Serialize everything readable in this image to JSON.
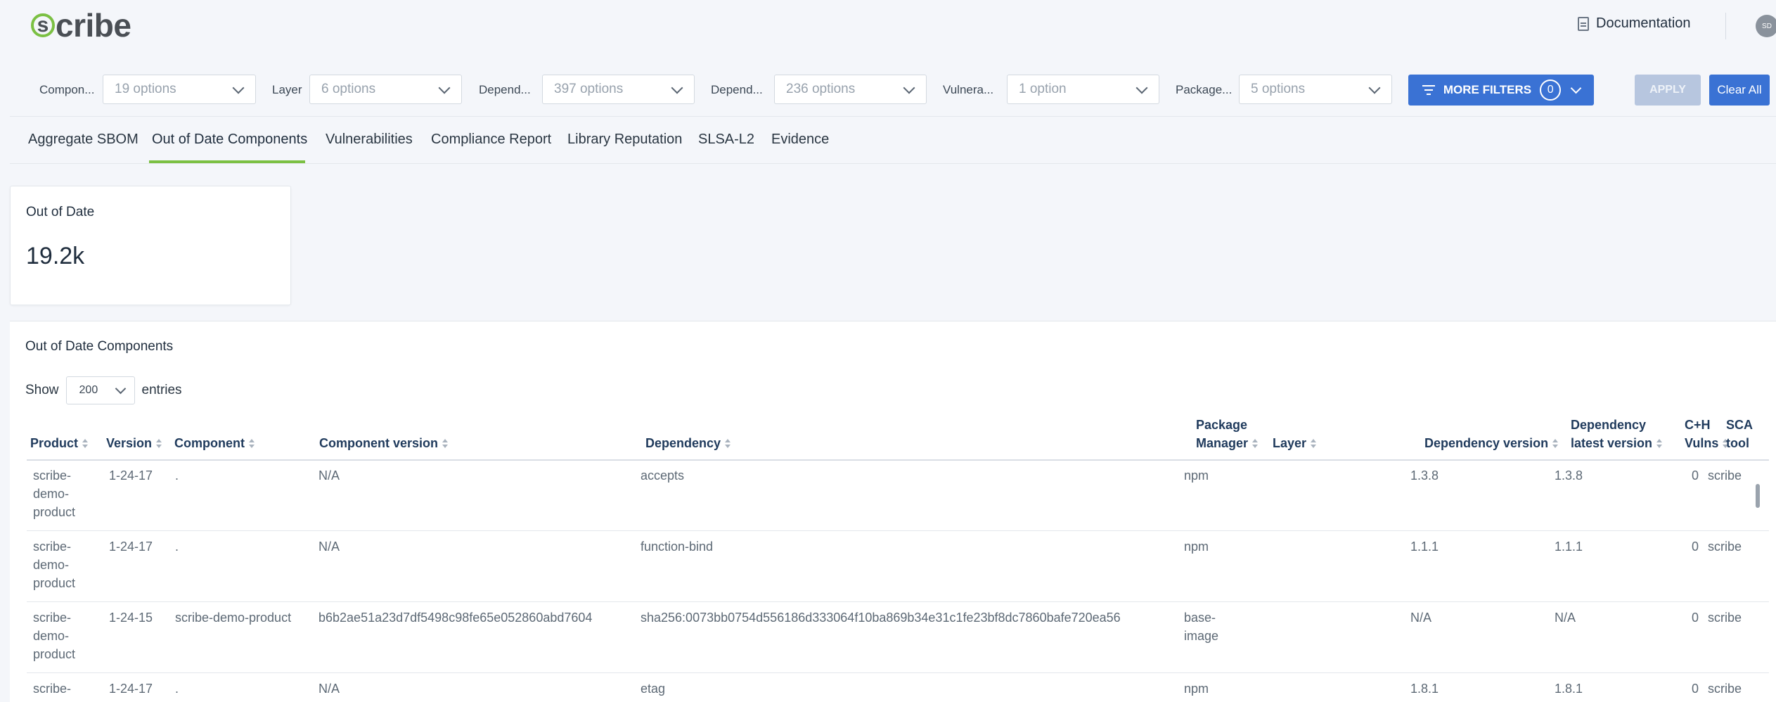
{
  "header": {
    "logo_initial": "s",
    "logo_rest": "cribe",
    "documentation": "Documentation",
    "avatar_initials": "SD"
  },
  "filters": {
    "items": [
      {
        "label": "Compon...",
        "value": "19 options"
      },
      {
        "label": "Layer",
        "value": "6 options"
      },
      {
        "label": "Depend...",
        "value": "397 options"
      },
      {
        "label": "Depend...",
        "value": "236 options"
      },
      {
        "label": "Vulnera...",
        "value": "1 option"
      },
      {
        "label": "Package...",
        "value": "5 options"
      }
    ],
    "more_filters": "MORE FILTERS",
    "more_filters_count": "0",
    "apply": "APPLY",
    "clear_all": "Clear All"
  },
  "tabs": [
    {
      "label": "Aggregate SBOM"
    },
    {
      "label": "Out of Date Components"
    },
    {
      "label": "Vulnerabilities"
    },
    {
      "label": "Compliance Report"
    },
    {
      "label": "Library Reputation"
    },
    {
      "label": "SLSA-L2"
    },
    {
      "label": "Evidence"
    }
  ],
  "active_tab": "Out of Date Components",
  "stat_card": {
    "title": "Out of Date",
    "value": "19.2k"
  },
  "table": {
    "title": "Out of Date Components",
    "show_label": "Show",
    "entries_label": "entries",
    "page_size": "200",
    "columns": [
      {
        "label": "Product"
      },
      {
        "label": "Version"
      },
      {
        "label": "Component"
      },
      {
        "label": "Component version"
      },
      {
        "label": "Dependency"
      },
      {
        "label_line1": "Package",
        "label_line2": "Manager"
      },
      {
        "label": "Layer"
      },
      {
        "label": "Dependency version"
      },
      {
        "label_line1": "Dependency",
        "label_line2": "latest version"
      },
      {
        "label_line1": "C+H",
        "label_line2": "Vulns"
      },
      {
        "label_line1": "SCA",
        "label_line2": "tool"
      }
    ],
    "rows": [
      {
        "product": "scribe-demo-product",
        "version": "1-24-17",
        "component": ".",
        "component_version": "N/A",
        "dependency": "accepts",
        "package_manager": "npm",
        "layer": "",
        "dependency_version": "1.3.8",
        "latest_version": "1.3.8",
        "vulns": "0",
        "sca_tool": "scribe"
      },
      {
        "product": "scribe-demo-product",
        "version": "1-24-17",
        "component": ".",
        "component_version": "N/A",
        "dependency": "function-bind",
        "package_manager": "npm",
        "layer": "",
        "dependency_version": "1.1.1",
        "latest_version": "1.1.1",
        "vulns": "0",
        "sca_tool": "scribe"
      },
      {
        "product": "scribe-demo-product",
        "version": "1-24-15",
        "component": "scribe-demo-product",
        "component_version": "b6b2ae51a23d7df5498c98fe65e052860abd7604",
        "dependency": "sha256:0073bb0754d556186d333064f10ba869b34e31c1fe23bf8dc7860bafe720ea56",
        "package_manager": "base-image",
        "layer": "",
        "dependency_version": "N/A",
        "latest_version": "N/A",
        "vulns": "0",
        "sca_tool": "scribe"
      },
      {
        "product": "scribe-",
        "version": "1-24-17",
        "component": ".",
        "component_version": "N/A",
        "dependency": "etag",
        "package_manager": "npm",
        "layer": "",
        "dependency_version": "1.8.1",
        "latest_version": "1.8.1",
        "vulns": "0",
        "sca_tool": "scribe"
      }
    ]
  }
}
